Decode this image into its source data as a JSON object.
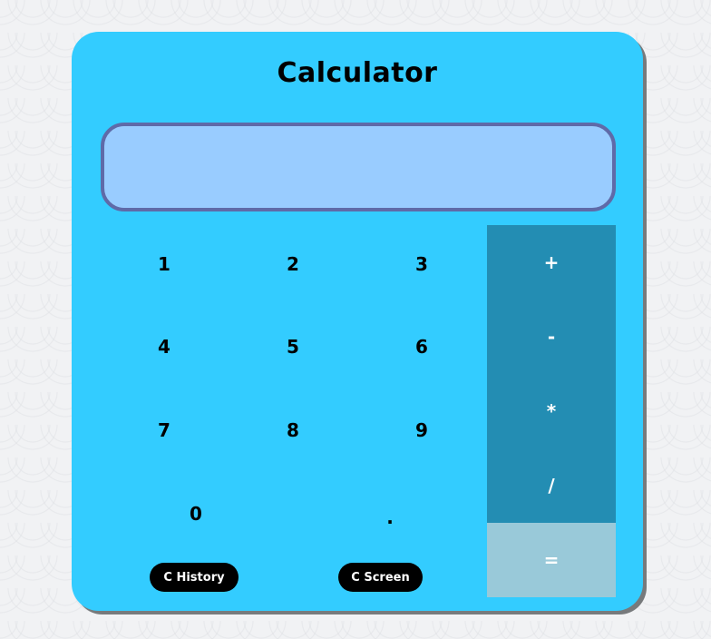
{
  "app": {
    "title": "Calculator"
  },
  "screen": {
    "value": ""
  },
  "keys": {
    "k1": "1",
    "k2": "2",
    "k3": "3",
    "k4": "4",
    "k5": "5",
    "k6": "6",
    "k7": "7",
    "k8": "8",
    "k9": "9",
    "k0": "0",
    "dot": "."
  },
  "operators": {
    "plus": "+",
    "minus": "-",
    "multiply": "*",
    "divide": "/",
    "equals": "="
  },
  "actions": {
    "clear_history": "C History",
    "clear_screen": "C Screen"
  },
  "colors": {
    "panel": "#33ccff",
    "screen_bg": "#99ccff",
    "screen_border": "#5f6aa8",
    "operator_bg": "#238db3",
    "equals_bg": "#99c9d9",
    "pill_bg": "#000000"
  }
}
